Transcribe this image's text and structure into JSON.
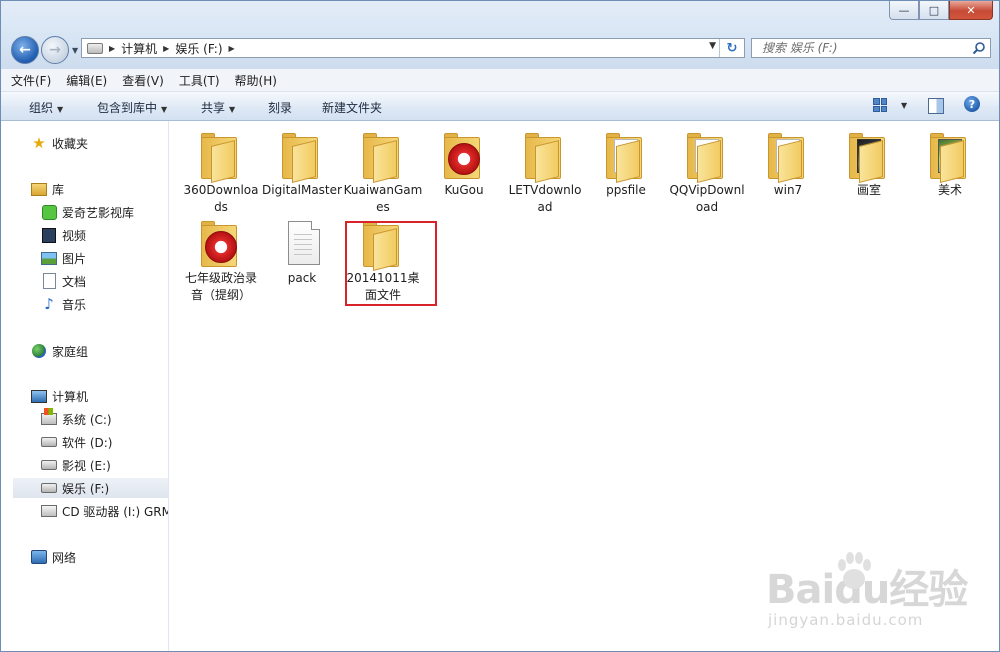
{
  "window": {
    "controls": {
      "minimize": "—",
      "maximize": "□",
      "close": "✕"
    }
  },
  "address": {
    "crumbs": [
      "计算机",
      "娱乐 (F:)"
    ]
  },
  "search": {
    "placeholder": "搜索 娱乐 (F:)"
  },
  "menu": [
    "文件(F)",
    "编辑(E)",
    "查看(V)",
    "工具(T)",
    "帮助(H)"
  ],
  "toolbar": {
    "organize": "组织",
    "include_library": "包含到库中",
    "share": "共享",
    "burn": "刻录",
    "new_folder": "新建文件夹"
  },
  "sidebar": {
    "favorites": "收藏夹",
    "libraries": "库",
    "library_items": [
      "爱奇艺影视库",
      "视频",
      "图片",
      "文档",
      "音乐"
    ],
    "homegroup": "家庭组",
    "computer": "计算机",
    "drives": [
      "系统 (C:)",
      "软件 (D:)",
      "影视 (E:)",
      "娱乐 (F:)",
      "CD 驱动器 (I:) GRM"
    ],
    "selected_drive": "娱乐 (F:)",
    "network": "网络"
  },
  "files": [
    {
      "name": "360Downloads",
      "type": "folder"
    },
    {
      "name": "DigitalMaster",
      "type": "folder"
    },
    {
      "name": "KuaiwanGames",
      "type": "folder"
    },
    {
      "name": "KuGou",
      "type": "kugou-folder"
    },
    {
      "name": "LETVdownload",
      "type": "folder"
    },
    {
      "name": "ppsfile",
      "type": "folder-papers"
    },
    {
      "name": "QQVipDownload",
      "type": "folder-papers"
    },
    {
      "name": "win7",
      "type": "folder-papers"
    },
    {
      "name": "画室",
      "type": "folder-photo"
    },
    {
      "name": "美术",
      "type": "folder-art"
    },
    {
      "name": "七年级政治录音（提纲）",
      "type": "kugou-folder"
    },
    {
      "name": "pack",
      "type": "file"
    },
    {
      "name": "20141011桌面文件",
      "type": "folder",
      "highlighted": true
    }
  ],
  "watermark": {
    "logo": "Baidu经验",
    "url": "jingyan.baidu.com"
  },
  "colors": {
    "highlight": "#d8232a",
    "folder": "#f2cb61",
    "accent": "#2d6fbd"
  }
}
